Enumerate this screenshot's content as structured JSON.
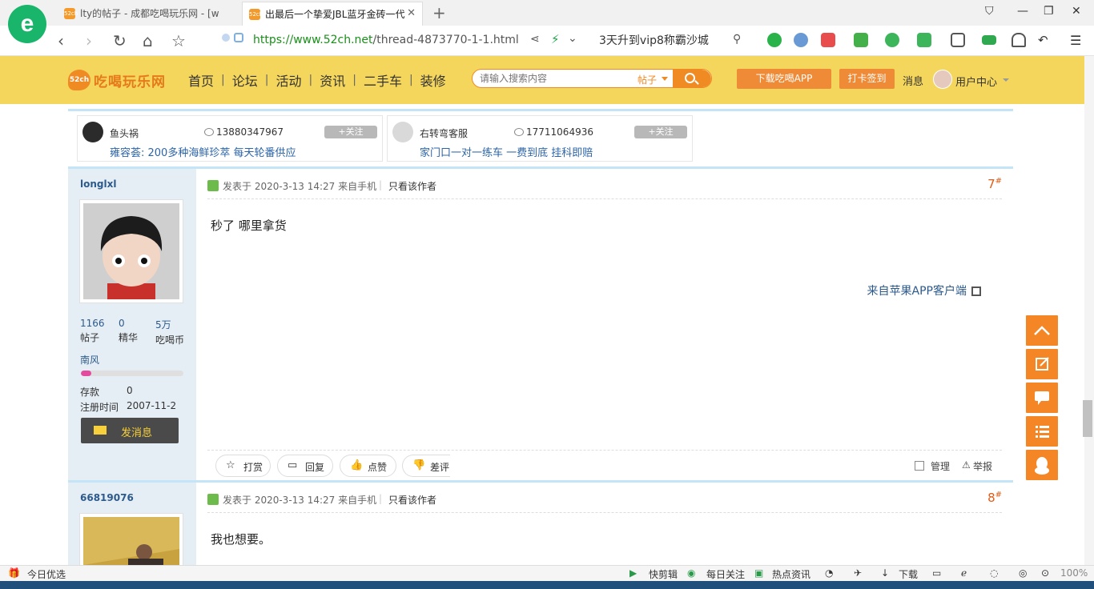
{
  "browser": {
    "tabs": [
      {
        "label": "lty的帖子 - 成都吃喝玩乐网 - [w",
        "favicon": "52ch"
      },
      {
        "label": "出最后一个挚爱JBL蓝牙金砖一代",
        "favicon": "52ch"
      }
    ],
    "url": {
      "scheme": "https://",
      "host": "www.52ch.net",
      "path": "/thread-4873770-1-1.html"
    },
    "search_hint": "3天升到vip8称霸沙城"
  },
  "site": {
    "logo_badge": "52ch",
    "logo_text": "吃喝玩乐网",
    "nav": [
      "首页",
      "论坛",
      "活动",
      "资讯",
      "二手车",
      "装修"
    ],
    "search_placeholder": "请输入搜索内容",
    "search_scope": "帖子",
    "download_app": "下载吃喝APP",
    "checkin": "打卡签到",
    "messages": "消息",
    "user_center": "用户中心",
    "accent_color": "#f08a23",
    "header_color": "#f5d65c"
  },
  "ads": [
    {
      "name": "鱼头祸",
      "phone": "13880347967",
      "follow": "+关注",
      "desc": "雍容荟: 200多种海鲜珍萃 每天轮番供应"
    },
    {
      "name": "右转弯客服",
      "phone": "17711064936",
      "follow": "+关注",
      "desc": "家门口一对一练车 一费到底 挂科即赔"
    }
  ],
  "posts": [
    {
      "author": "longlxl",
      "stats": [
        {
          "num": "1166",
          "label": "帖子"
        },
        {
          "num": "0",
          "label": "精华"
        },
        {
          "num": "5万",
          "label": "吃喝币"
        }
      ],
      "rank": "南风",
      "rank_progress": 0.1,
      "deposit_label": "存款",
      "deposit": "0",
      "reg_label": "注册时间",
      "reg_date": "2007-11-2",
      "pm": "发消息",
      "time": "发表于 2020-3-13 14:27 来自手机",
      "only_author": "只看该作者",
      "floor": "7",
      "floor_mark": "#",
      "content": "秒了 哪里拿货",
      "from_app": "来自苹果APP客户端",
      "actions": [
        "打赏",
        "回复",
        "点赞",
        "差评"
      ],
      "manage": "管理",
      "report": "举报"
    },
    {
      "author": "66819076",
      "time": "发表于 2020-3-13 14:27 来自手机",
      "only_author": "只看该作者",
      "floor": "8",
      "floor_mark": "#",
      "content": "我也想要。"
    }
  ],
  "statusbar": {
    "left": "今日优选",
    "items": [
      "快剪辑",
      "每日关注",
      "热点资讯",
      "下载"
    ],
    "zoom": "100%"
  }
}
